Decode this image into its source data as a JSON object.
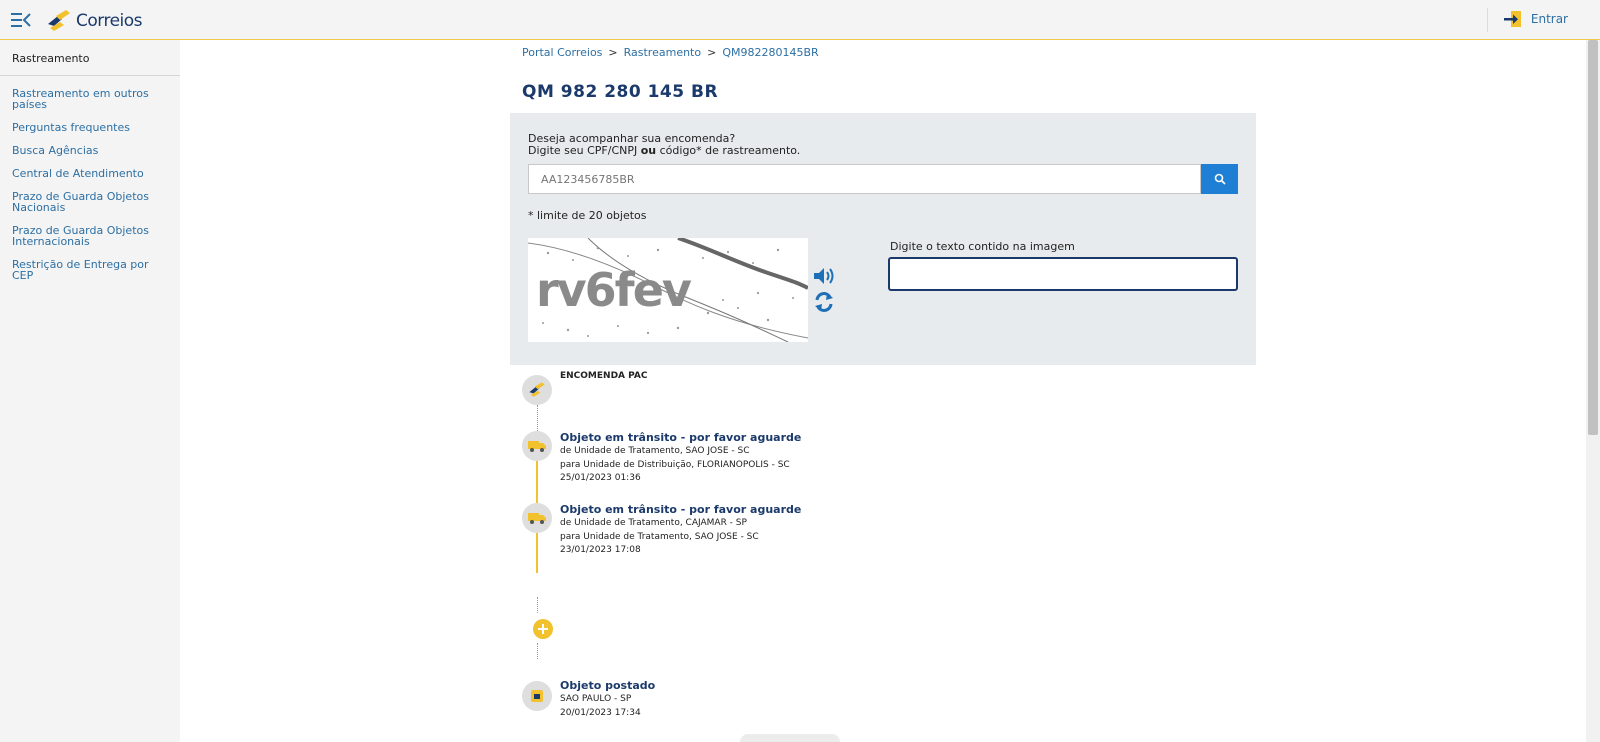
{
  "header": {
    "logo_text": "Correios",
    "login_label": "Entrar"
  },
  "sidebar": {
    "title": "Rastreamento",
    "items": [
      {
        "label": "Rastreamento em outros países"
      },
      {
        "label": "Perguntas frequentes"
      },
      {
        "label": "Busca Agências"
      },
      {
        "label": "Central de Atendimento"
      },
      {
        "label": "Prazo de Guarda Objetos Nacionais"
      },
      {
        "label": "Prazo de Guarda Objetos Internacionais"
      },
      {
        "label": "Restrição de Entrega por CEP"
      }
    ]
  },
  "breadcrumb": {
    "items": [
      "Portal Correios",
      "Rastreamento",
      "QM982280145BR"
    ],
    "separator": ">"
  },
  "page_title": "QM 982 280 145 BR",
  "search": {
    "prompt_line1": "Deseja acompanhar sua encomenda?",
    "prompt_line2_a": "Digite seu CPF/CNPJ ",
    "prompt_line2_bold": "ou",
    "prompt_line2_b": " código* de rastreamento.",
    "placeholder": "AA123456785BR",
    "limit_note": "* limite de 20 objetos",
    "captcha_text": "rv6fev",
    "captcha_label": "Digite o texto contido na imagem",
    "captcha_value": ""
  },
  "timeline": {
    "header": "ENCOMENDA PAC",
    "events": [
      {
        "title": "Objeto em trânsito - por favor aguarde",
        "from": "de Unidade de Tratamento, SAO JOSE - SC",
        "to": "para Unidade de Distribuição, FLORIANOPOLIS - SC",
        "datetime": "25/01/2023 01:36",
        "icon": "truck-icon"
      },
      {
        "title": "Objeto em trânsito - por favor aguarde",
        "from": "de Unidade de Tratamento, CAJAMAR - SP",
        "to": "para Unidade de Tratamento, SAO JOSE - SC",
        "datetime": "23/01/2023 17:08",
        "icon": "truck-icon"
      },
      {
        "title": "Objeto postado",
        "location": "SAO PAULO - SP",
        "datetime": "20/01/2023 17:34",
        "icon": "mailbox-icon"
      }
    ]
  },
  "colors": {
    "brand_blue": "#1b3a6b",
    "link_blue": "#2d6fa3",
    "brand_yellow": "#f2c12e",
    "search_button": "#1e7fd4"
  }
}
